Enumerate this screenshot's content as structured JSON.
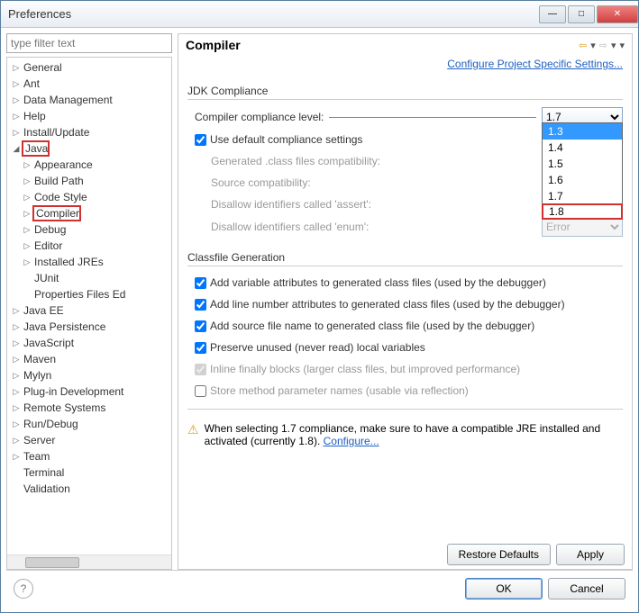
{
  "window": {
    "title": "Preferences"
  },
  "left": {
    "filter_placeholder": "type filter text",
    "tree": [
      {
        "label": "General",
        "tw": "▷",
        "indent": 0
      },
      {
        "label": "Ant",
        "tw": "▷",
        "indent": 0
      },
      {
        "label": "Data Management",
        "tw": "▷",
        "indent": 0
      },
      {
        "label": "Help",
        "tw": "▷",
        "indent": 0
      },
      {
        "label": "Install/Update",
        "tw": "▷",
        "indent": 0
      },
      {
        "label": "Java",
        "tw": "◢",
        "indent": 0,
        "hl": true
      },
      {
        "label": "Appearance",
        "tw": "▷",
        "indent": 1
      },
      {
        "label": "Build Path",
        "tw": "▷",
        "indent": 1
      },
      {
        "label": "Code Style",
        "tw": "▷",
        "indent": 1
      },
      {
        "label": "Compiler",
        "tw": "▷",
        "indent": 1,
        "hl": true
      },
      {
        "label": "Debug",
        "tw": "▷",
        "indent": 1
      },
      {
        "label": "Editor",
        "tw": "▷",
        "indent": 1
      },
      {
        "label": "Installed JREs",
        "tw": "▷",
        "indent": 1
      },
      {
        "label": "JUnit",
        "tw": "",
        "indent": 1
      },
      {
        "label": "Properties Files Ed",
        "tw": "",
        "indent": 1
      },
      {
        "label": "Java EE",
        "tw": "▷",
        "indent": 0
      },
      {
        "label": "Java Persistence",
        "tw": "▷",
        "indent": 0
      },
      {
        "label": "JavaScript",
        "tw": "▷",
        "indent": 0
      },
      {
        "label": "Maven",
        "tw": "▷",
        "indent": 0
      },
      {
        "label": "Mylyn",
        "tw": "▷",
        "indent": 0
      },
      {
        "label": "Plug-in Development",
        "tw": "▷",
        "indent": 0
      },
      {
        "label": "Remote Systems",
        "tw": "▷",
        "indent": 0
      },
      {
        "label": "Run/Debug",
        "tw": "▷",
        "indent": 0
      },
      {
        "label": "Server",
        "tw": "▷",
        "indent": 0
      },
      {
        "label": "Team",
        "tw": "▷",
        "indent": 0
      },
      {
        "label": "Terminal",
        "tw": "",
        "indent": 0
      },
      {
        "label": "Validation",
        "tw": "",
        "indent": 0
      }
    ]
  },
  "right": {
    "title": "Compiler",
    "project_link": "Configure Project Specific Settings...",
    "jdk_group": "JDK Compliance",
    "compliance_label": "Compiler compliance level:",
    "compliance_value": "1.7",
    "default_compliance": "Use default compliance settings",
    "gen_class": "Generated .class files compatibility:",
    "src_compat": "Source compatibility:",
    "assert": "Disallow identifiers called 'assert':",
    "enum": "Disallow identifiers called 'enum':",
    "enum_value": "Error",
    "dropdown_options": [
      "1.3",
      "1.4",
      "1.5",
      "1.6",
      "1.7",
      "1.8"
    ],
    "dropdown_selected": "1.3",
    "dropdown_highlighted": "1.8",
    "classfile_group": "Classfile Generation",
    "var_attr": "Add variable attributes to generated class files (used by the debugger)",
    "line_num": "Add line number attributes to generated class files (used by the debugger)",
    "src_file": "Add source file name to generated class file (used by the debugger)",
    "preserve": "Preserve unused (never read) local variables",
    "inline": "Inline finally blocks (larger class files, but improved performance)",
    "store": "Store method parameter names (usable via reflection)",
    "warning": "When selecting 1.7 compliance, make sure to have a compatible JRE installed and activated (currently 1.8).",
    "configure_link": "Configure...",
    "restore": "Restore Defaults",
    "apply": "Apply"
  },
  "bottom": {
    "ok": "OK",
    "cancel": "Cancel"
  }
}
